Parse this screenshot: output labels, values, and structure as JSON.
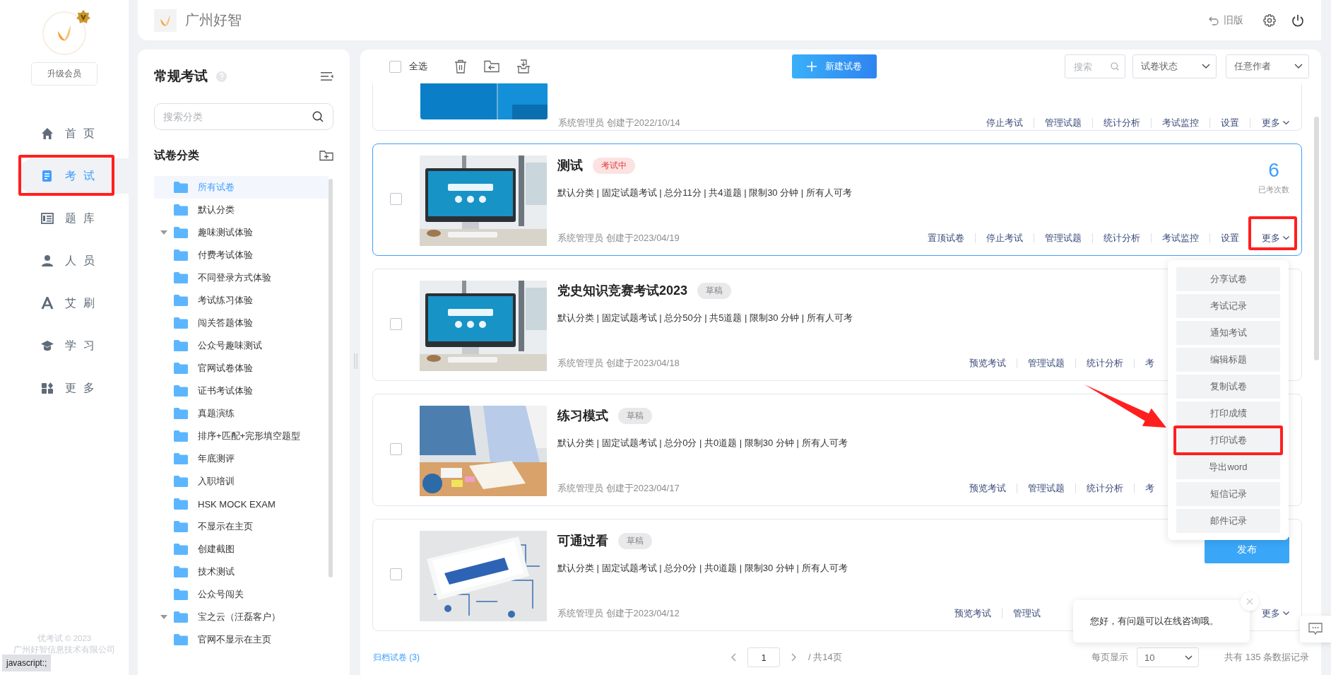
{
  "sidebar": {
    "upgrade": "升级会员",
    "nav": [
      {
        "label": "首页",
        "selected": false
      },
      {
        "label": "考试",
        "selected": true
      },
      {
        "label": "题库",
        "selected": false
      },
      {
        "label": "人员",
        "selected": false
      },
      {
        "label": "艾刷",
        "selected": false
      },
      {
        "label": "学习",
        "selected": false
      },
      {
        "label": "更多",
        "selected": false
      }
    ],
    "footer": [
      "优考试 © 2023",
      "广州好智信息技术有限公司"
    ],
    "status_link": "javascript:;"
  },
  "topbar": {
    "brand": "广州好智",
    "old_version": "旧版"
  },
  "category_panel": {
    "title": "常规考试",
    "search": {
      "placeholder": "搜索分类"
    },
    "section": "试卷分类",
    "tree": [
      {
        "label": "所有试卷",
        "selected": true,
        "expanded": false
      },
      {
        "label": "默认分类",
        "selected": false,
        "expanded": false
      },
      {
        "label": "趣味测试体验",
        "selected": false,
        "expanded": true,
        "children": [
          {
            "label": "付费考试体验",
            "selected": false,
            "expanded": false
          },
          {
            "label": "不同登录方式体验",
            "selected": false,
            "expanded": false
          },
          {
            "label": "考试练习体验",
            "selected": false,
            "expanded": false
          },
          {
            "label": "闯关答题体验",
            "selected": false,
            "expanded": false
          },
          {
            "label": "公众号趣味测试",
            "selected": false,
            "expanded": false
          },
          {
            "label": "官网试卷体验",
            "selected": false,
            "expanded": false
          },
          {
            "label": "证书考试体验",
            "selected": false,
            "expanded": false
          },
          {
            "label": "真题演练",
            "selected": false,
            "expanded": false
          },
          {
            "label": "排序+匹配+完形填空题型",
            "selected": false,
            "expanded": false
          },
          {
            "label": "年底测评",
            "selected": false,
            "expanded": false
          },
          {
            "label": "入职培训",
            "selected": false,
            "expanded": false
          },
          {
            "label": "HSK MOCK EXAM",
            "selected": false,
            "expanded": false
          },
          {
            "label": "不显示在主页",
            "selected": false,
            "expanded": false
          },
          {
            "label": "创建截图",
            "selected": false,
            "expanded": false
          },
          {
            "label": "技术测试",
            "selected": false,
            "expanded": false
          },
          {
            "label": "公众号闯关",
            "selected": false,
            "expanded": false
          }
        ]
      },
      {
        "label": "宝之云（汪磊客户）",
        "selected": false,
        "expanded": true,
        "children": [
          {
            "label": "官网不显示在主页",
            "selected": false,
            "expanded": false
          }
        ]
      }
    ]
  },
  "toolbar": {
    "select_all": {
      "label": "全选",
      "checked": false
    },
    "new_button": "新建试卷",
    "search": {
      "placeholder": "搜索"
    },
    "filters": [
      "试卷状态",
      "任意作者"
    ]
  },
  "cards": [
    {
      "kind": "clipped",
      "selected": false,
      "image": {
        "kind": "picture"
      },
      "creator": "系统管理员 创建于2022/10/14",
      "actions": [
        "停止考试",
        "管理试题",
        "统计分析",
        "考试监控",
        "设置"
      ],
      "more": "更多"
    },
    {
      "kind": "full",
      "selected": true,
      "checked": false,
      "image": {
        "kind": "picture"
      },
      "title": "测试",
      "tag": {
        "text": "考试中",
        "kind": "running"
      },
      "meta": "默认分类 | 固定试题考试 | 总分11分 | 共4道题 | 限制30 分钟 | 所有人可考",
      "count": {
        "value": "6",
        "label": "已考次数"
      },
      "creator": "系统管理员 创建于2023/04/19",
      "actions": [
        "置顶试卷",
        "停止考试",
        "管理试题",
        "统计分析",
        "考试监控",
        "设置"
      ],
      "more": "更多",
      "menu": [
        "分享试卷",
        "考试记录",
        "通知考试",
        "编辑标题",
        "复制试卷",
        "打印成绩",
        "打印试卷",
        "导出word",
        "短信记录",
        "邮件记录"
      ]
    },
    {
      "kind": "full",
      "selected": false,
      "checked": false,
      "image": {
        "kind": "picture"
      },
      "title": "党史知识竞赛考试2023",
      "tag": {
        "text": "草稿",
        "kind": "draft"
      },
      "meta": "默认分类 | 固定试题考试 | 总分50分 | 共5道题 | 限制30 分钟 | 所有人可考",
      "creator": "系统管理员 创建于2023/04/18",
      "actions": [
        "预览考试",
        "管理试题",
        "统计分析",
        "考"
      ]
    },
    {
      "kind": "full",
      "selected": false,
      "checked": false,
      "image": {
        "kind": "picture"
      },
      "title": "练习模式",
      "tag": {
        "text": "草稿",
        "kind": "draft"
      },
      "meta": "默认分类 | 固定试题考试 | 总分0分 | 共0道题 | 限制30 分钟 | 所有人可考",
      "creator": "系统管理员 创建于2023/04/17",
      "actions": [
        "预览考试",
        "管理试题",
        "统计分析",
        "考"
      ]
    },
    {
      "kind": "full",
      "selected": false,
      "checked": false,
      "image": {
        "kind": "picture"
      },
      "title": "可通过看",
      "tag": {
        "text": "草稿",
        "kind": "draft"
      },
      "meta": "默认分类 | 固定试题考试 | 总分0分 | 共0道题 | 限制30 分钟 | 所有人可考",
      "publish": "发布",
      "creator": "系统管理员 创建于2023/04/12",
      "actions": [
        "预览考试",
        "管理试"
      ],
      "more": "更多"
    }
  ],
  "footer": {
    "archive": "归档试卷 (3)",
    "page": "1",
    "pages": "/ 共14页",
    "per_page_label": "每页显示",
    "per_page": "10",
    "total": "共有 135 条数据记录"
  },
  "chat": {
    "message": "您好，有问题可以在线咨询哦。"
  }
}
